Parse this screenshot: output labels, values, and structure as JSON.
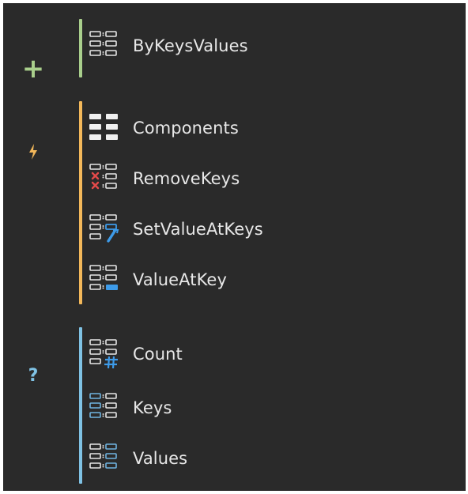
{
  "groups": [
    {
      "id": "create",
      "marker": "+",
      "marker_icon": "plus-icon",
      "color": "#a9cf8c",
      "items": [
        {
          "label": "ByKeysValues",
          "icon": "by-keys-values-icon"
        }
      ]
    },
    {
      "id": "action",
      "marker": "⚡",
      "marker_icon": "lightning-icon",
      "color": "#f3b85a",
      "items": [
        {
          "label": "Components",
          "icon": "components-icon"
        },
        {
          "label": "RemoveKeys",
          "icon": "remove-keys-icon"
        },
        {
          "label": "SetValueAtKeys",
          "icon": "set-value-at-keys-icon"
        },
        {
          "label": "ValueAtKey",
          "icon": "value-at-key-icon"
        }
      ]
    },
    {
      "id": "query",
      "marker": "?",
      "marker_icon": "question-icon",
      "color": "#7fc2e4",
      "items": [
        {
          "label": "Count",
          "icon": "count-icon"
        },
        {
          "label": "Keys",
          "icon": "keys-icon"
        },
        {
          "label": "Values",
          "icon": "values-icon"
        }
      ]
    }
  ],
  "icon_colors": {
    "outline": "#e6e6e6",
    "fill": "#f0f0f0",
    "blue": "#3d9be9",
    "light_blue": "#6fb3e0",
    "red": "#e24a4a"
  }
}
